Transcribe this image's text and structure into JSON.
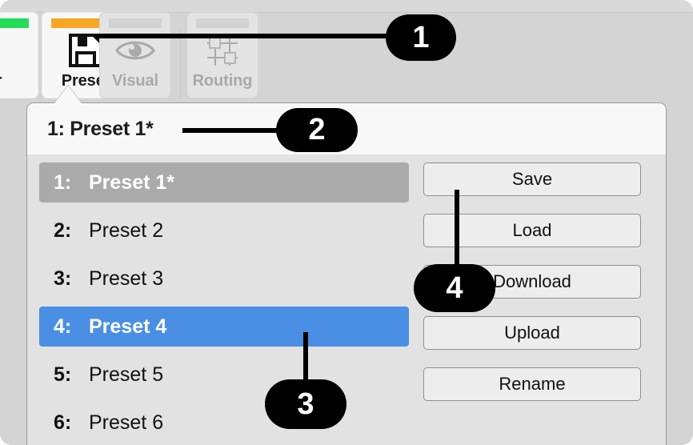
{
  "window": {
    "background_color": "#d4d4d4"
  },
  "tab_bar": {
    "tabs": [
      {
        "id": "mixer",
        "label": "er",
        "icon": "mixer-icon",
        "indicator_color": "#22dd55",
        "state": "inactive-cropped"
      },
      {
        "id": "preset",
        "label": "Preset",
        "icon": "floppy-disk-save-icon",
        "indicator_color": "#f5a623",
        "state": "active"
      },
      {
        "id": "visual",
        "label": "Visual",
        "icon": "eye-icon",
        "indicator_color": "#d2d2d2",
        "state": "inactive"
      },
      {
        "id": "routing",
        "label": "Routing",
        "icon": "routing-grid-icon",
        "indicator_color": "#d2d2d2",
        "state": "inactive"
      }
    ]
  },
  "popover": {
    "title": "1: Preset 1*",
    "header_background": "#f8f8f8",
    "body_background": "#e2e2e2",
    "presets": [
      {
        "index": "1:",
        "name": "Preset 1*",
        "state": "current"
      },
      {
        "index": "2:",
        "name": "Preset 2",
        "state": "normal"
      },
      {
        "index": "3:",
        "name": "Preset 3",
        "state": "normal"
      },
      {
        "index": "4:",
        "name": "Preset 4",
        "state": "selected"
      },
      {
        "index": "5:",
        "name": "Preset 5",
        "state": "normal"
      },
      {
        "index": "6:",
        "name": "Preset 6",
        "state": "normal"
      }
    ],
    "selected_color": "#4a8fe3",
    "current_color": "#aaaaaa",
    "actions": [
      {
        "id": "save",
        "label": "Save"
      },
      {
        "id": "load",
        "label": "Load"
      },
      {
        "id": "download",
        "label": "Download"
      },
      {
        "id": "upload",
        "label": "Upload"
      },
      {
        "id": "rename",
        "label": "Rename"
      }
    ]
  },
  "annotations": {
    "badge_color": "#000000",
    "items": [
      {
        "id": "1",
        "number": "1"
      },
      {
        "id": "2",
        "number": "2"
      },
      {
        "id": "3",
        "number": "3"
      },
      {
        "id": "4",
        "number": "4"
      }
    ]
  }
}
